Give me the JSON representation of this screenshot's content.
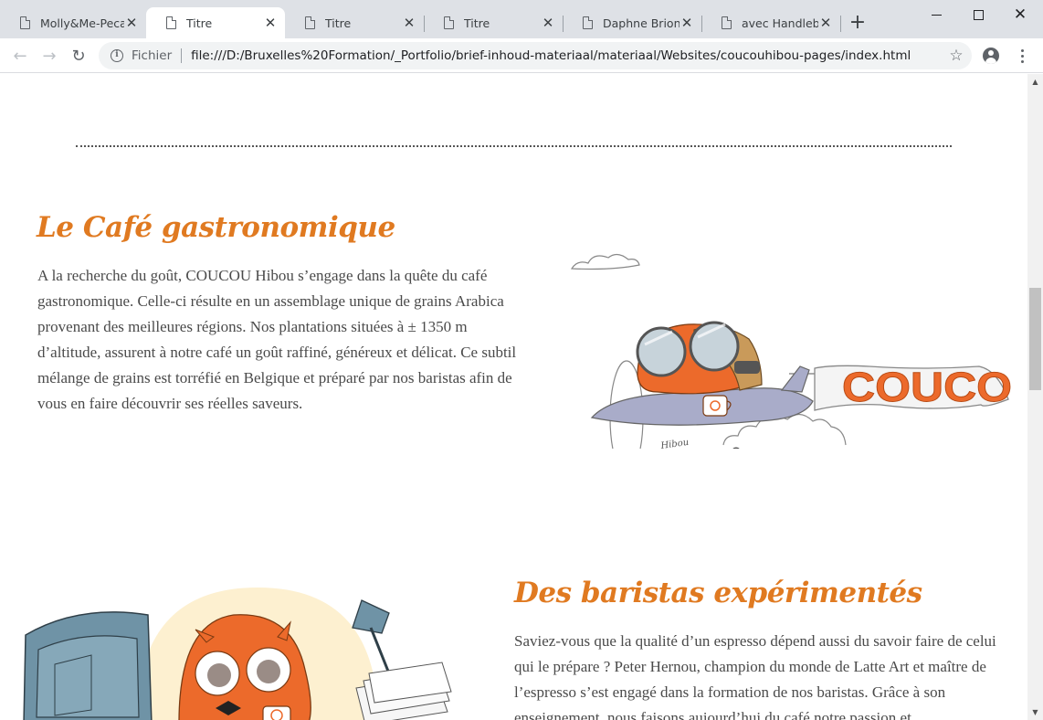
{
  "browser": {
    "tabs": [
      {
        "title": "Molly&Me-Pecan",
        "active": false
      },
      {
        "title": "Titre",
        "active": true
      },
      {
        "title": "Titre",
        "active": false
      },
      {
        "title": "Titre",
        "active": false
      },
      {
        "title": "Daphne Brion - P",
        "active": false
      },
      {
        "title": "avec Handlebars",
        "active": false
      }
    ],
    "new_tab_glyph": "+",
    "address": {
      "scheme_label": "Fichier",
      "url": "file:///D:/Bruxelles%20Formation/_Portfolio/brief-inhoud-materiaal/materiaal/Websites/coucouhibou-pages/index.html"
    }
  },
  "page": {
    "section1": {
      "heading": "Le Café gastronomique",
      "paragraph": "A la recherche du goût, COUCOU Hibou s’engage dans la quête du café gastronomique. Celle-ci résulte en un assemblage unique de grains Arabica provenant des meilleures régions. Nos plantations situées à ± 1350 m d’altitude, assurent à notre café un goût raffiné, généreux et délicat. Ce subtil mélange de grains est torréfié en Belgique et préparé par nos baristas afin de vous en faire découvrir ses réelles saveurs.",
      "banner_text": "COUCOU",
      "signature": "Hibou"
    },
    "section2": {
      "heading": "Des baristas expérimentés",
      "paragraph": "Saviez-vous que la qualité d’un espresso dépend aussi du savoir faire de celui qui le prépare ? Peter Hernou, champion du monde de Latte Art et maître de l’espresso s’est engagé dans la formation de nos baristas. Grâce à son enseignement, nous faisons aujourd’hui du café notre passion et"
    }
  },
  "colors": {
    "accent": "#e07a21",
    "body_text": "#4a4a4a",
    "owl_orange": "#ec6a2b",
    "plane": "#a9acc9",
    "desk_blue": "#6f93a6",
    "halo": "#fdf0d0"
  }
}
